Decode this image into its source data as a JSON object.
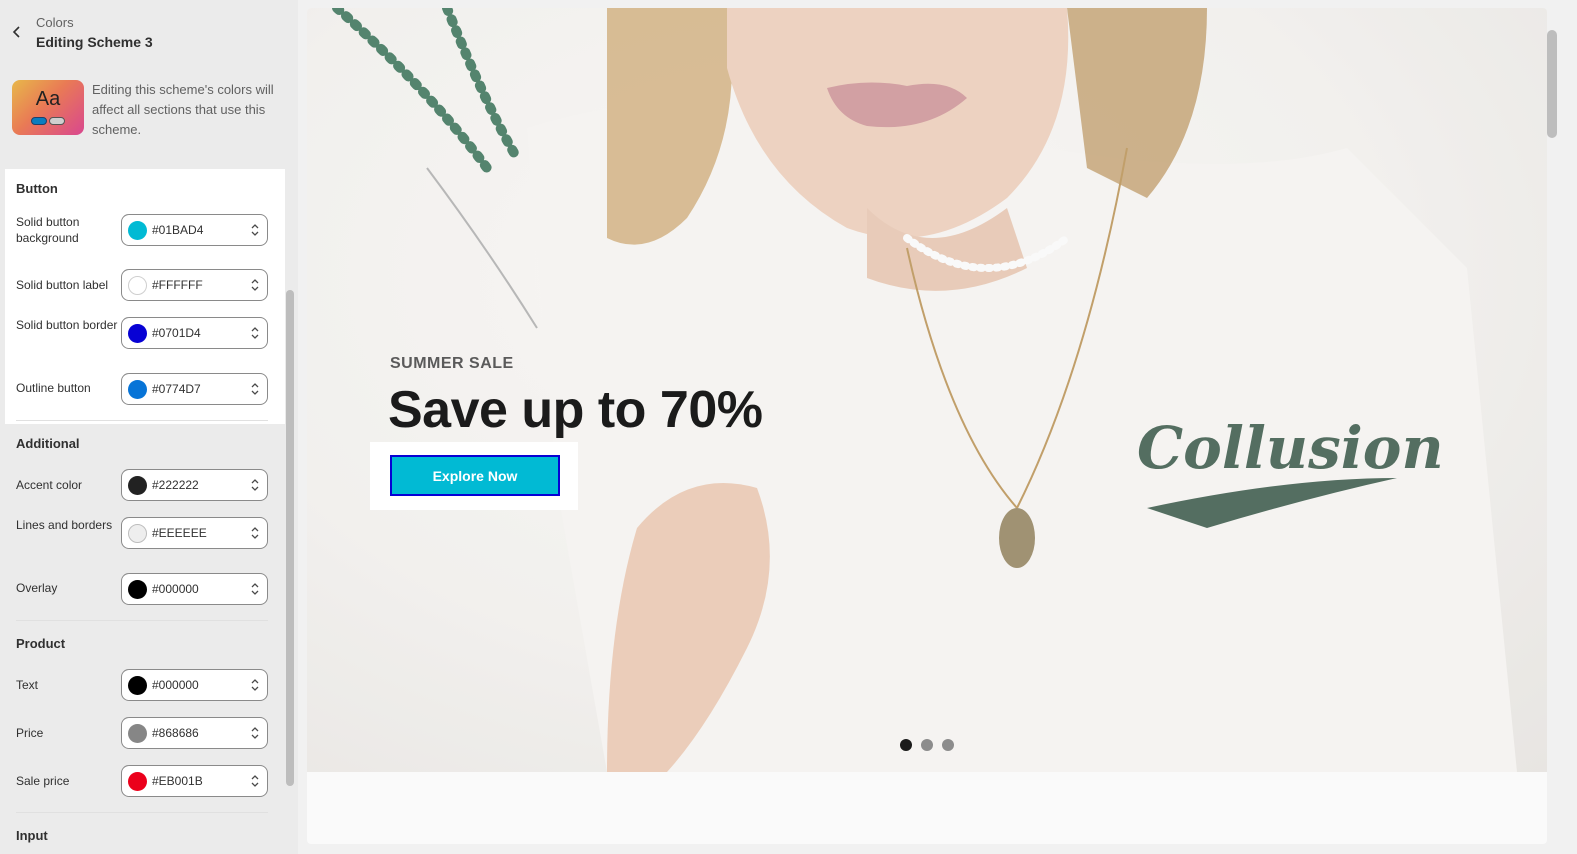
{
  "sidebar": {
    "breadcrumb": "Colors",
    "title": "Editing Scheme 3",
    "preview_text": "Aa",
    "note": "Editing this scheme's colors will affect all sections that use this scheme.",
    "sections": {
      "button": {
        "title": "Button",
        "fields": [
          {
            "label": "Solid button background",
            "value": "#01BAD4"
          },
          {
            "label": "Solid button label",
            "value": "#FFFFFF"
          },
          {
            "label": "Solid button border",
            "value": "#0701D4"
          },
          {
            "label": "Outline button",
            "value": "#0774D7"
          }
        ]
      },
      "additional": {
        "title": "Additional",
        "fields": [
          {
            "label": "Accent color",
            "value": "#222222"
          },
          {
            "label": "Lines and borders",
            "value": "#EEEEEE"
          },
          {
            "label": "Overlay",
            "value": "#000000"
          }
        ]
      },
      "product": {
        "title": "Product",
        "fields": [
          {
            "label": "Text",
            "value": "#000000"
          },
          {
            "label": "Price",
            "value": "#868686"
          },
          {
            "label": "Sale price",
            "value": "#EB001B"
          }
        ]
      },
      "input": {
        "title": "Input"
      }
    }
  },
  "hero": {
    "subtitle": "SUMMER SALE",
    "title": "Save up to 70%",
    "cta_label": "Explore Now",
    "brand_print": "Collusion",
    "slides": 3,
    "active_slide": 1
  },
  "icons": {
    "back": "chevron-left-icon",
    "stepper": "chevron-up-down-icon"
  }
}
